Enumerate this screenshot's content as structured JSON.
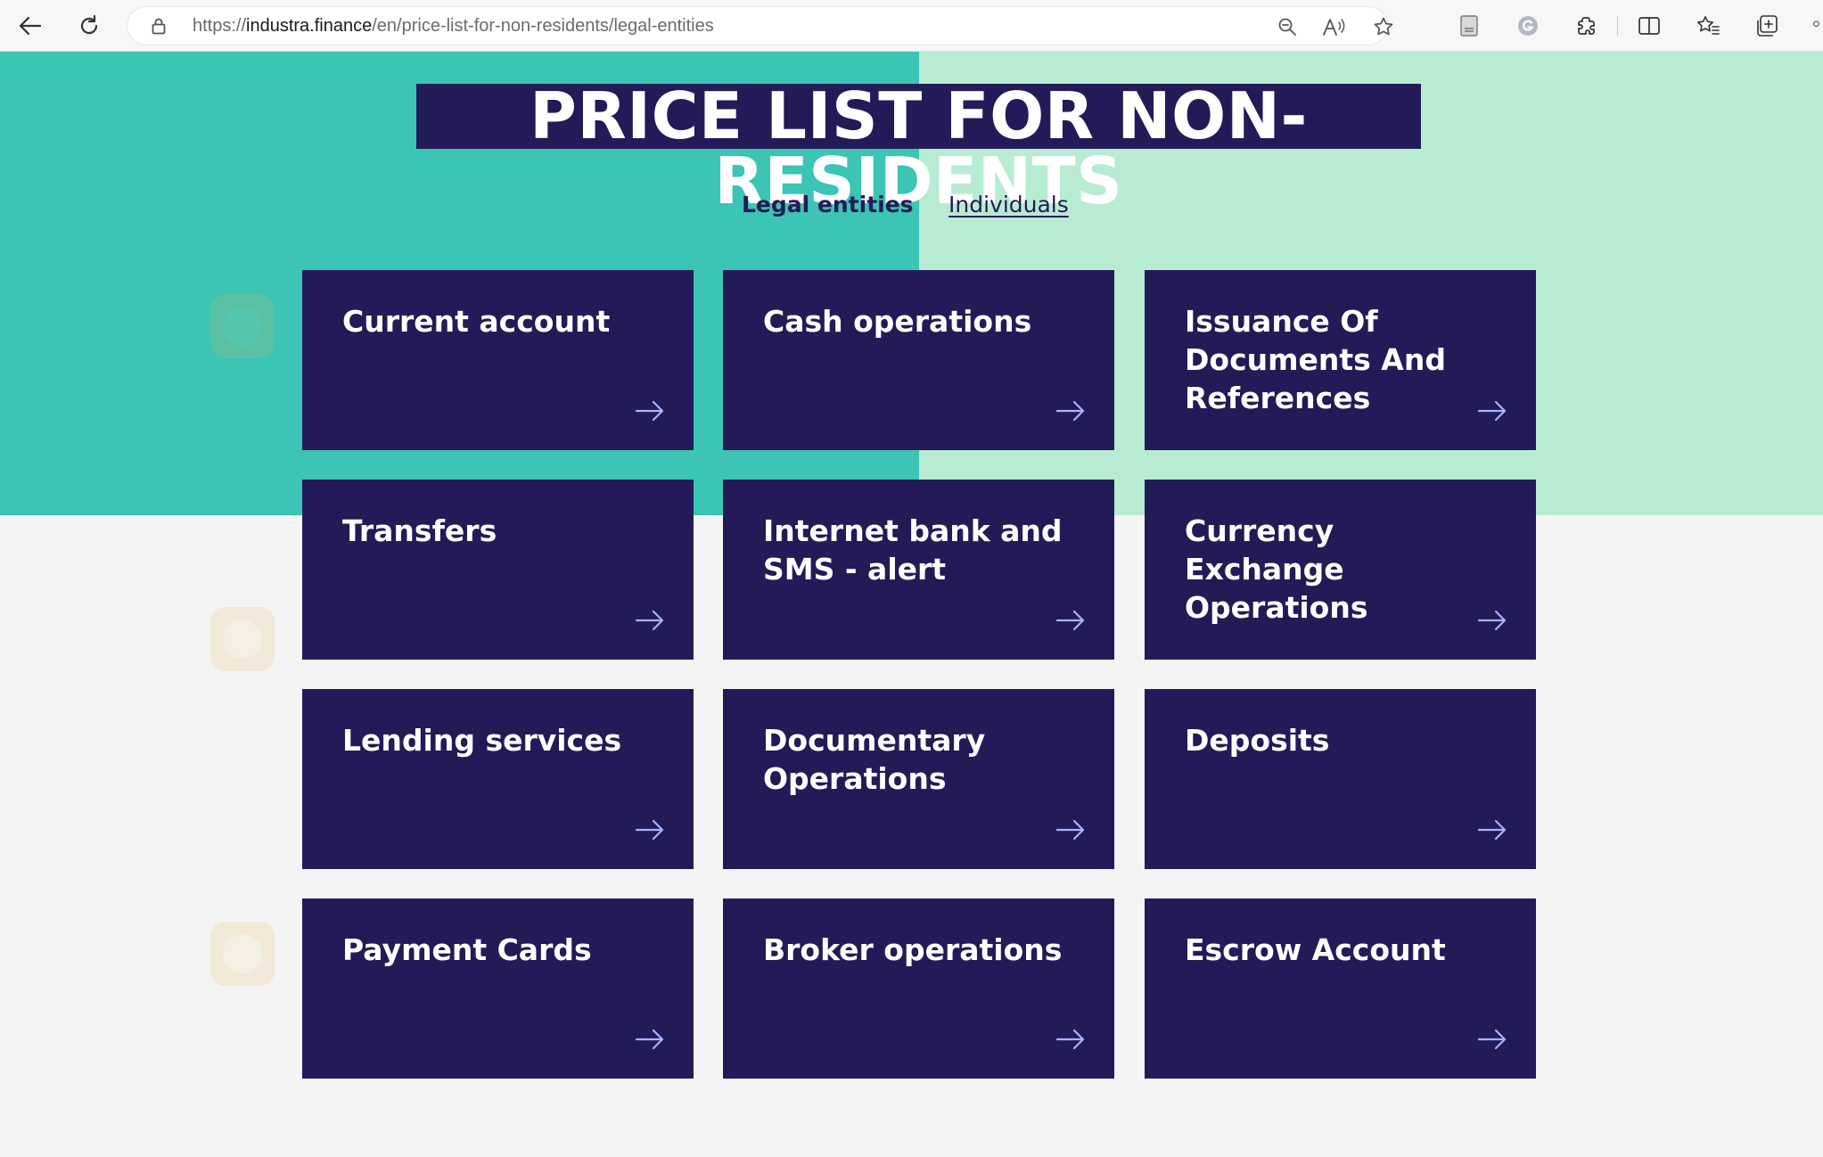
{
  "browser": {
    "url_scheme": "https://",
    "url_host": "industra.finance",
    "url_path": "/en/price-list-for-non-residents/legal-entities"
  },
  "page": {
    "title": "PRICE LIST FOR NON-RESIDENTS",
    "tabs": [
      {
        "label": "Legal entities",
        "active": true
      },
      {
        "label": "Individuals",
        "active": false
      }
    ]
  },
  "cards": [
    {
      "label": "Current account"
    },
    {
      "label": "Cash operations"
    },
    {
      "label": "Issuance Of Documents And References"
    },
    {
      "label": "Transfers"
    },
    {
      "label": "Internet bank and SMS - alert"
    },
    {
      "label": "Currency Exchange Operations"
    },
    {
      "label": "Lending services"
    },
    {
      "label": "Documentary Operations"
    },
    {
      "label": "Deposits"
    },
    {
      "label": "Payment Cards"
    },
    {
      "label": "Broker operations"
    },
    {
      "label": "Escrow Account"
    }
  ],
  "colors": {
    "card_bg": "#231b57",
    "hero_left": "#3cc4b5",
    "hero_right": "#b8ecd2",
    "arrow": "#a9b3ff"
  },
  "icons": {
    "back": "arrow-left-icon",
    "refresh": "refresh-icon",
    "lock": "lock-icon",
    "card_arrow": "arrow-right-icon"
  }
}
